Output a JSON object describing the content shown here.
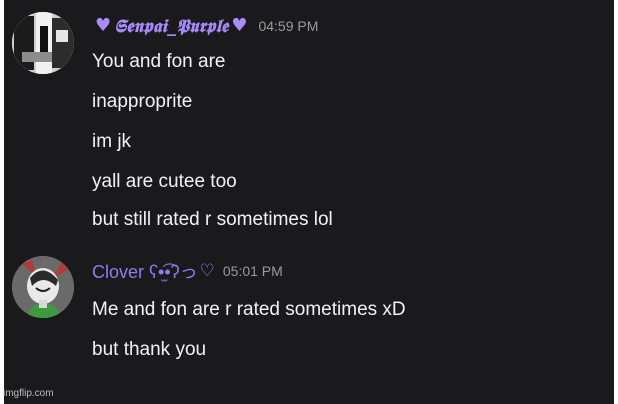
{
  "messages": [
    {
      "username": "𝕾𝖊𝖓𝖕𝖆𝖎_𝕻𝖚𝖗𝖕𝖑𝖊",
      "timestamp": "04:59 PM",
      "lines": [
        "You and fon are",
        "inapproprite",
        "im jk",
        "yall are cutee too",
        "but still rated r sometimes lol"
      ]
    },
    {
      "username": "Clover ʕ•̫͡•ʔっ",
      "timestamp": "05:01 PM",
      "lines": [
        "Me and fon are r rated sometimes xD",
        "but thank you"
      ]
    }
  ],
  "watermark": "imgflip.com",
  "colors": {
    "background": "#1a1a1d",
    "username": "#a58af5",
    "message_text": "#f2f2f2",
    "timestamp": "#9a9a9a"
  }
}
